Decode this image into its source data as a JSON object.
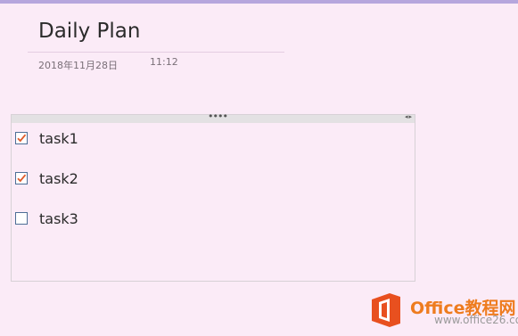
{
  "colors": {
    "background": "#fbebf7",
    "top_bar": "#b6a6dd",
    "checkbox_border": "#4d6e96",
    "checkmark": "#e05a2a",
    "watermark_orange": "#ee7c1f"
  },
  "page": {
    "title": "Daily Plan",
    "date": "2018年11月28日",
    "time": "11:12"
  },
  "outline": {
    "handle_dots": "••••",
    "handle_arrows": "◂▸",
    "tasks": [
      {
        "label": "task1",
        "checked": true
      },
      {
        "label": "task2",
        "checked": true
      },
      {
        "label": "task3",
        "checked": false
      }
    ]
  },
  "watermark": {
    "main_text": "Office教程网",
    "sub_text": "www.office26.com",
    "icon": "office-logo-icon"
  }
}
